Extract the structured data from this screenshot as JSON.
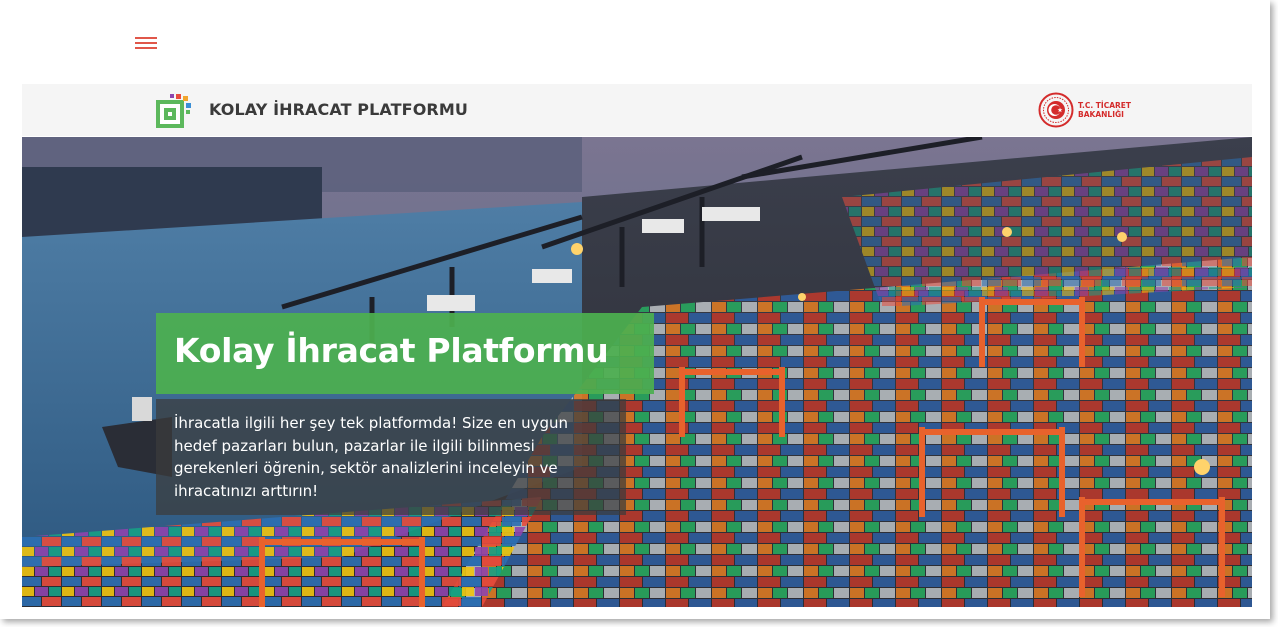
{
  "nav": {
    "menu_icon": "hamburger-menu-icon"
  },
  "header": {
    "brand_title": "KOLAY İHRACAT PLATFORMU",
    "logo_icon": "pixel-grid-logo",
    "ministry_line1": "T.C. TİCARET",
    "ministry_line2": "BAKANLIĞI",
    "ministry_icon": "ministry-seal-logo"
  },
  "hero": {
    "title": "Kolay İhracat Platformu",
    "description": "İhracatla ilgili her şey tek platformda! Size en uygun hedef pazarları bulun, pazarlar ile ilgili bilinmesi gerekenleri öğrenin, sektör analizlerini inceleyin ve ihracatınızı arttırın!",
    "background_image": "container-port-photo"
  },
  "colors": {
    "accent_green": "#4caf50",
    "menu_red": "#e0574a",
    "ministry_red": "#d42b2b",
    "brand_text": "#3a3a3a"
  }
}
